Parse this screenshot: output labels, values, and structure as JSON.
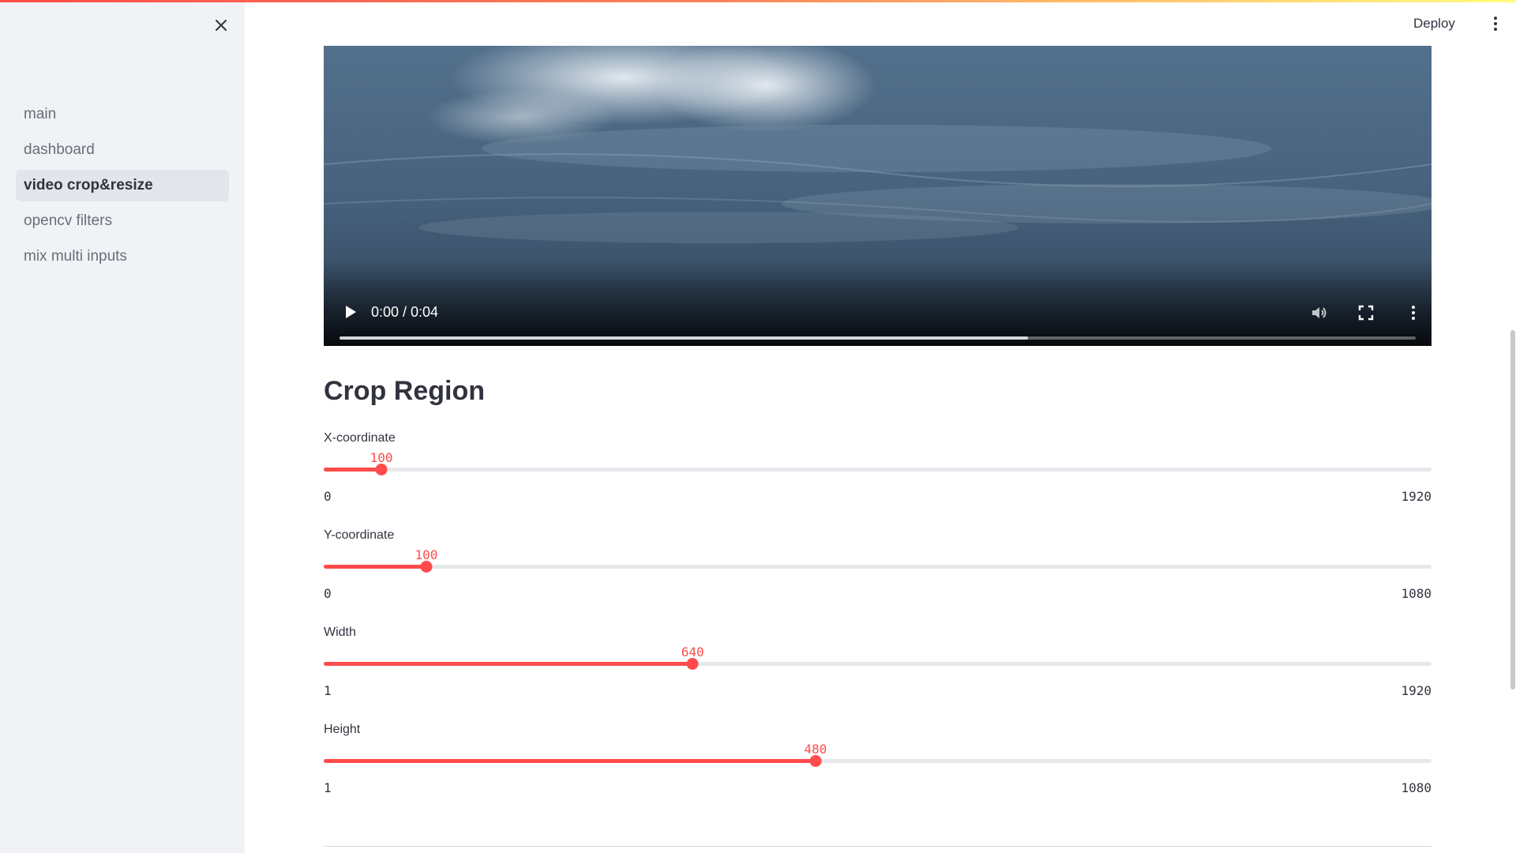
{
  "sidebar": {
    "items": [
      {
        "label": "main",
        "active": false
      },
      {
        "label": "dashboard",
        "active": false
      },
      {
        "label": "video crop&resize",
        "active": true
      },
      {
        "label": "opencv filters",
        "active": false
      },
      {
        "label": "mix multi inputs",
        "active": false
      }
    ]
  },
  "header": {
    "deploy_label": "Deploy"
  },
  "video": {
    "time": "0:00 / 0:04",
    "progress": 0.64
  },
  "crop": {
    "title": "Crop Region",
    "sliders": [
      {
        "label": "X-coordinate",
        "value": "100",
        "min": "0",
        "max": "1920"
      },
      {
        "label": "Y-coordinate",
        "value": "100",
        "min": "0",
        "max": "1080"
      },
      {
        "label": "Width",
        "value": "640",
        "min": "1",
        "max": "1920"
      },
      {
        "label": "Height",
        "value": "480",
        "min": "1",
        "max": "1080"
      }
    ]
  },
  "colors": {
    "accent": "#ff4b4b",
    "sidebar_bg": "#f0f2f6",
    "text": "#31333f"
  }
}
